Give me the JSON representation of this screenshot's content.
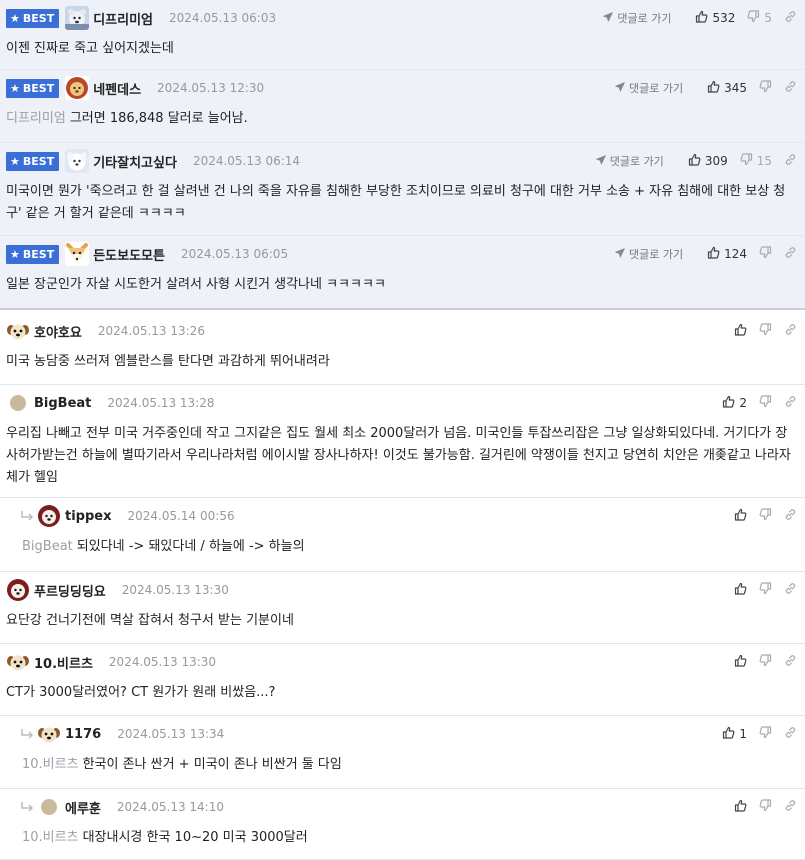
{
  "comments": [
    {
      "best": true,
      "badge": "BEST",
      "nick": "디프리미엄",
      "date": "2024.05.13 06:03",
      "goto": "댓글로 가기",
      "up": "532",
      "down": "5",
      "mention": "",
      "text": "이젠 진짜로 죽고 싶어지겠는데",
      "avatar": "polarbear-avatar"
    },
    {
      "best": true,
      "badge": "BEST",
      "nick": "네펜데스",
      "date": "2024.05.13 12:30",
      "goto": "댓글로 가기",
      "up": "345",
      "down": "",
      "mention": "디프리미엄",
      "text": "그러면 186,848 달러로 늘어남.",
      "avatar": "lion-avatar"
    },
    {
      "best": true,
      "badge": "BEST",
      "nick": "기타잘치고싶다",
      "date": "2024.05.13 06:14",
      "goto": "댓글로 가기",
      "up": "309",
      "down": "15",
      "mention": "",
      "text": "미국이면 뭔가 '죽으려고 한 걸 살려낸 건 나의 죽을 자유를 침해한 부당한 조치이므로 의료비 청구에 대한 거부 소송 + 자유 침해에 대한 보상 청구' 같은 거 할거 같은데 ㅋㅋㅋㅋ",
      "avatar": "white-dog-avatar"
    },
    {
      "best": true,
      "badge": "BEST",
      "nick": "든도보도모튼",
      "date": "2024.05.13 06:05",
      "goto": "댓글로 가기",
      "up": "124",
      "down": "",
      "mention": "",
      "text": "일본 장군인가 자살 시도한거 살려서 사형 시킨거 생각나네 ㅋㅋㅋㅋㅋ",
      "avatar": "fox-avatar"
    },
    {
      "best": false,
      "nick": "호야호요",
      "date": "2024.05.13 13:26",
      "up": "",
      "down": "",
      "mention": "",
      "text": "미국 농담중 쓰러져 엠블란스를 탄다면 과감하게 뛰어내려라",
      "avatar": "puppy-avatar"
    },
    {
      "best": false,
      "nick": "BigBeat",
      "date": "2024.05.13 13:28",
      "up": "2",
      "down": "",
      "mention": "",
      "text": "우리집 나빼고 전부 미국 거주중인데 작고 그지같은 집도 월세 최소 2000달러가 넘음. 미국인들 투잡쓰리잡은 그냥 일상화되있다네. 거기다가 장사허가받는건 하늘에 별따기라서 우리나라처럼 에이시발 장사나하자! 이것도 불가능함. 길거린에 약쟁이들 천지고 당연히 치안은 개좆같고 나라자체가 헬임",
      "avatar": "default-avatar"
    },
    {
      "best": false,
      "reply": true,
      "nick": "tippex",
      "date": "2024.05.14 00:56",
      "up": "",
      "down": "",
      "mention": "BigBeat",
      "text": "되있다네 -> 돼있다네 / 하늘에 -> 하늘의",
      "avatar": "red-dog-avatar"
    },
    {
      "best": false,
      "nick": "푸르딩딩딩요",
      "date": "2024.05.13 13:30",
      "up": "",
      "down": "",
      "mention": "",
      "text": "요단강 건너기전에 멱살 잡혀서 청구서 받는 기분이네",
      "avatar": "red-dog-avatar"
    },
    {
      "best": false,
      "nick": "10.비르츠",
      "date": "2024.05.13 13:30",
      "up": "",
      "down": "",
      "mention": "",
      "text": "CT가 3000달러였어? CT 원가가 원래 비쌌음...?",
      "avatar": "puppy-avatar"
    },
    {
      "best": false,
      "reply": true,
      "nick": "1176",
      "date": "2024.05.13 13:34",
      "up": "1",
      "down": "",
      "mention": "10.비르츠",
      "text": "한국이 존나 싼거 + 미국이 존나 비싼거 둘 다임",
      "avatar": "puppy-avatar"
    },
    {
      "best": false,
      "reply": true,
      "nick": "에루훈",
      "date": "2024.05.13 14:10",
      "up": "",
      "down": "",
      "mention": "10.비르츠",
      "text": "대장내시경 한국 10~20 미국 3000달러",
      "avatar": "default-avatar"
    }
  ],
  "colors": {
    "best_badge": "#3a6fd8",
    "best_bg": "#eef1f8",
    "mention": "#9aa0a8"
  }
}
